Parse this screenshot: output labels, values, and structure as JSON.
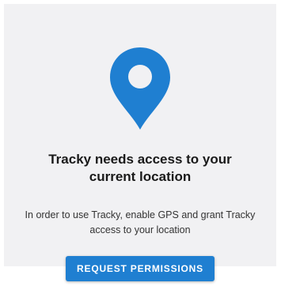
{
  "permission": {
    "icon": "location-pin-icon",
    "title": "Tracky needs access to your current location",
    "body": "In order to use Tracky, enable GPS and grant Tracky access to your location",
    "button_label": "REQUEST PERMISSIONS"
  },
  "colors": {
    "accent": "#1f7fd1",
    "card_background": "#f1f1f3"
  }
}
